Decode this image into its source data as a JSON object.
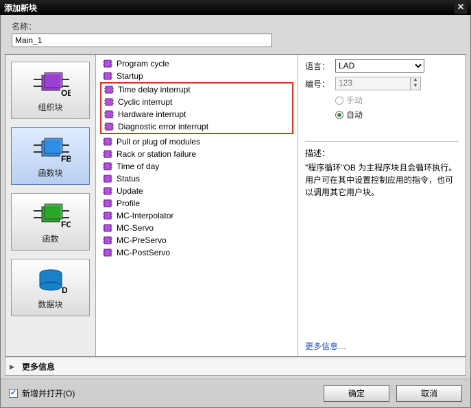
{
  "title": "添加新块",
  "name_label": "名称",
  "name_value": "Main_1",
  "sidebar": [
    {
      "id": "ob",
      "tag": "OB",
      "label": "组织块",
      "color": "#9b3fd6"
    },
    {
      "id": "fb",
      "tag": "FB",
      "label": "函数块",
      "color": "#2f8fe6",
      "selected": true
    },
    {
      "id": "fc",
      "tag": "FC",
      "label": "函数",
      "color": "#2aa82a"
    },
    {
      "id": "db",
      "tag": "DB",
      "label": "数据块",
      "color": "#1a80c8"
    }
  ],
  "items_top": [
    "Program cycle",
    "Startup"
  ],
  "items_highlight": [
    "Time delay interrupt",
    "Cyclic interrupt",
    "Hardware interrupt",
    "Diagnostic error interrupt"
  ],
  "items_bottom": [
    "Pull or plug of modules",
    "Rack or station failure",
    "Time of day",
    "Status",
    "Update",
    "Profile",
    "MC-Interpolator",
    "MC-Servo",
    "MC-PreServo",
    "MC-PostServo"
  ],
  "right": {
    "lang_label": "语言",
    "lang_value": "LAD",
    "num_label": "编号",
    "num_value": "123",
    "manual": "手动",
    "auto": "自动",
    "desc_label": "描述：",
    "desc_text": "\"程序循环\"OB 为主程序块且会循环执行。用户可在其中设置控制应用的指令，也可以调用其它用户块。",
    "more": "更多信息…"
  },
  "moreinfo_label": "更多信息",
  "footer": {
    "open_new": "新增并打开(O)",
    "ok": "确定",
    "cancel": "取消"
  }
}
